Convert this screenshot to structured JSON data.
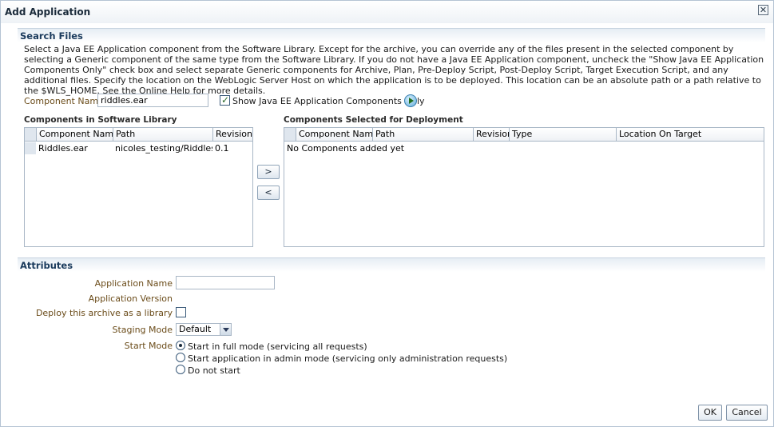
{
  "dialog": {
    "title": "Add Application",
    "close_glyph": "✕"
  },
  "search_files": {
    "title": "Search Files",
    "description": "Select a Java EE Application component from the Software Library. Except for the archive, you can override any of the files present in the selected component by selecting a Generic component of the same type from the Software Library. If you do not have a Java EE Application component, uncheck the \"Show Java EE Application Components Only\" check box and select separate Generic components for Archive, Plan, Pre-Deploy Script, Post-Deploy Script, Target Execution Script, and any additional files. Specify the location on the WebLogic Server Host on which the application is to be deployed. This location can be an absolute path or a path relative to the $WLS_HOME. See the Online Help for more details.",
    "component_name_label": "Component Name",
    "component_name_value": "riddles.ear",
    "show_only_label": "Show Java EE Application Components Only",
    "show_only_checked": true,
    "go_icon": "go-arrow-icon"
  },
  "library_table": {
    "title": "Components in Software Library",
    "columns": [
      "Component Name",
      "Path",
      "Revision"
    ],
    "rows": [
      {
        "name": "Riddles.ear",
        "path": "nicoles_testing/Riddles.ear",
        "revision": "0.1"
      }
    ]
  },
  "shuttle": {
    "move_right": ">",
    "move_left": "<"
  },
  "deploy_table": {
    "title": "Components Selected for Deployment",
    "columns": [
      "Component Name",
      "Path",
      "Revision",
      "Type",
      "Location On Target"
    ],
    "empty_text": "No Components added yet"
  },
  "attributes": {
    "title": "Attributes",
    "app_name_label": "Application Name",
    "app_name_value": "",
    "app_version_label": "Application Version",
    "deploy_library_label": "Deploy this archive as a library",
    "deploy_library_checked": false,
    "staging_mode_label": "Staging Mode",
    "staging_mode_value": "Default",
    "start_mode_label": "Start Mode",
    "start_modes": [
      {
        "label": "Start in full mode (servicing all requests)",
        "selected": true
      },
      {
        "label": "Start application in admin mode (servicing only administration requests)",
        "selected": false
      },
      {
        "label": "Do not start",
        "selected": false
      }
    ]
  },
  "footer": {
    "ok_label": "OK",
    "cancel_label": "Cancel"
  }
}
